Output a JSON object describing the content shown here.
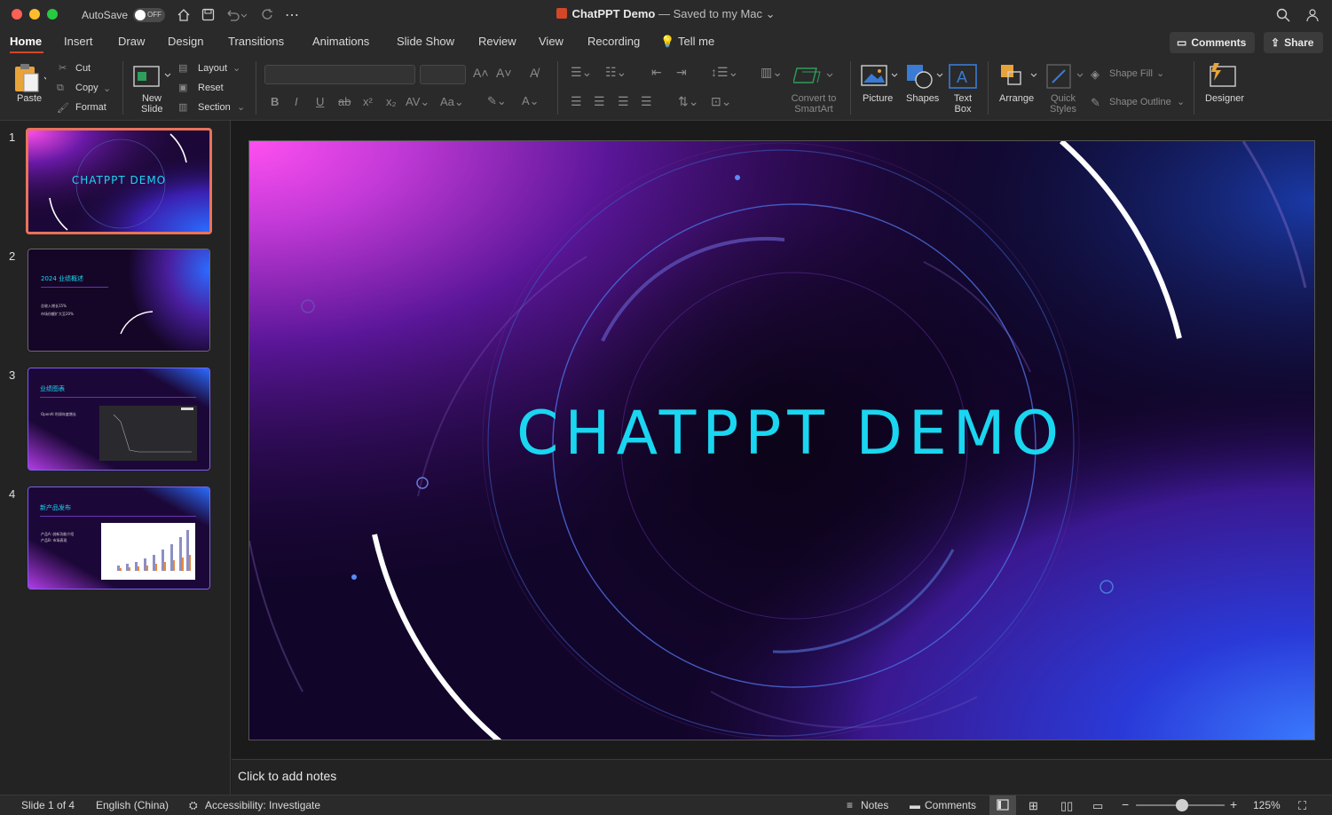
{
  "window": {
    "app_title": "ChatPPT Demo",
    "save_status": "— Saved to my Mac"
  },
  "autosave": {
    "label": "AutoSave",
    "state": "OFF"
  },
  "tabs": [
    "Home",
    "Insert",
    "Draw",
    "Design",
    "Transitions",
    "Animations",
    "Slide Show",
    "Review",
    "View",
    "Recording"
  ],
  "tell_me": "Tell me",
  "header_buttons": {
    "comments": "Comments",
    "share": "Share"
  },
  "ribbon": {
    "paste": "Paste",
    "cut": "Cut",
    "copy": "Copy",
    "format": "Format",
    "new_slide": "New Slide",
    "layout": "Layout",
    "reset": "Reset",
    "section": "Section",
    "convert_smartart": "Convert to SmartArt",
    "picture": "Picture",
    "shapes": "Shapes",
    "text_box": "Text Box",
    "arrange": "Arrange",
    "quick_styles": "Quick Styles",
    "shape_fill": "Shape Fill",
    "shape_outline": "Shape Outline",
    "designer": "Designer"
  },
  "slides": [
    {
      "num": "1",
      "title": "CHATPPT DEMO"
    },
    {
      "num": "2",
      "title": "2024 业绩概述",
      "bullets": [
        "总收入增长15%",
        "市场份额扩大至20%"
      ]
    },
    {
      "num": "3",
      "title": "业绩图表",
      "bullets": [
        "OpenAI 利润年度增长"
      ]
    },
    {
      "num": "4",
      "title": "新产品发布",
      "bullets": [
        "产品A: 创新功能介绍",
        "产品B: 市场表现"
      ]
    }
  ],
  "main_slide": {
    "title": "CHATPPT DEMO"
  },
  "notes_placeholder": "Click to add notes",
  "status": {
    "slide_info": "Slide 1 of 4",
    "language": "English (China)",
    "accessibility": "Accessibility: Investigate",
    "notes": "Notes",
    "comments": "Comments",
    "zoom": "125%"
  },
  "colors": {
    "accent": "#d24726",
    "title_cyan": "#1ad6f0"
  }
}
